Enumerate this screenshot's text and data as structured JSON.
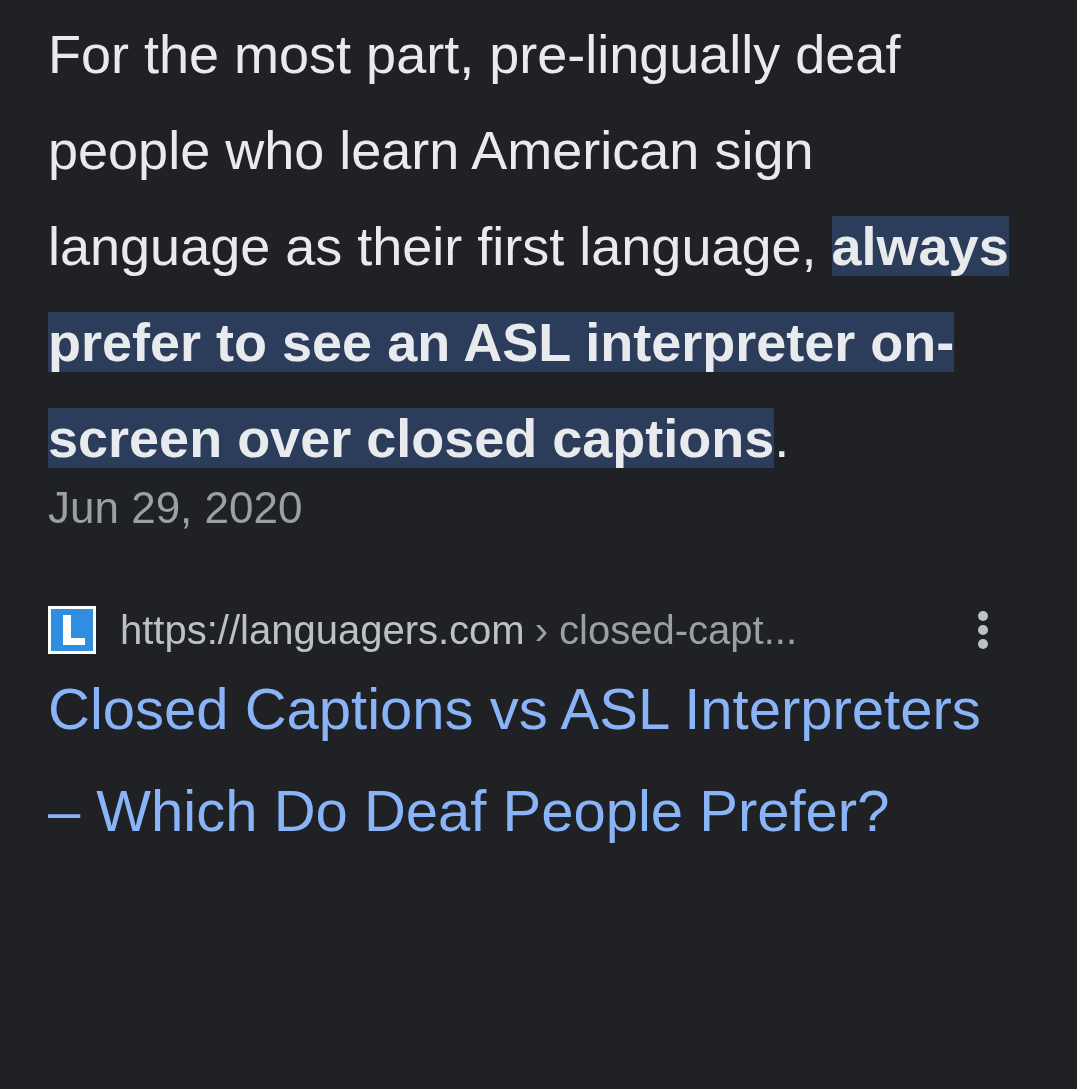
{
  "snippet": "For the most part, pre-lingually deaf people who learn American sign language as their first language, **always prefer to see an ASL interpreter on-screen over closed captions**.",
  "date": "Jun 29, 2020",
  "source": {
    "url": "https://languagers.com",
    "path": "› closed-capt..."
  },
  "title": "Closed Captions vs ASL Interpreters – Which Do Deaf People Prefer?"
}
